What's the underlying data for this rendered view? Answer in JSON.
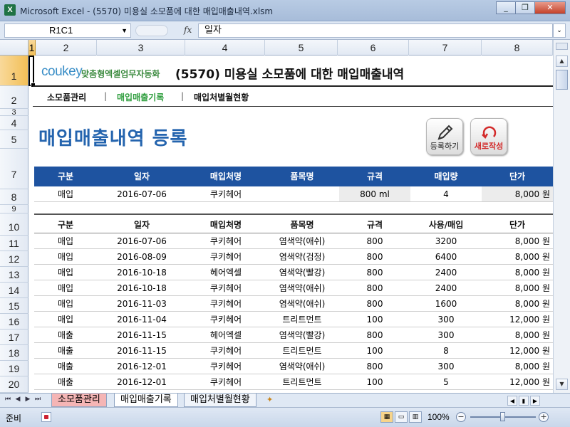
{
  "window": {
    "title": "Microsoft Excel - (5570) 미용실 소모품에 대한 매입매출내역.xlsm",
    "app_icon": "X",
    "minimize": "_",
    "restore": "❐",
    "close": "✕"
  },
  "formula_bar": {
    "name_box": "R1C1",
    "fx": "fx",
    "content": "일자"
  },
  "columns": [
    "1",
    "2",
    "3",
    "4",
    "5",
    "6",
    "7",
    "8"
  ],
  "rows": [
    "1",
    "2",
    "3",
    "4",
    "5",
    "7",
    "8",
    "9",
    "10",
    "11",
    "12",
    "13",
    "14",
    "15",
    "16",
    "17",
    "18",
    "19",
    "20"
  ],
  "header": {
    "brand": "coukey",
    "brand_sub": "맞춤형엑셀업무자동화",
    "title": "(5570) 미용실 소모품에 대한 매입매출내역"
  },
  "nav": {
    "item1": "소모품관리",
    "sep": "|",
    "item2": "매입매출기록",
    "item3": "매입처별월현황"
  },
  "page": {
    "heading": "매입매출내역 등록",
    "register_button": "등록하기",
    "new_button": "새로작성"
  },
  "entry_table": {
    "headers": [
      "구분",
      "일자",
      "매입처명",
      "품목명",
      "규격",
      "매입량",
      "단가"
    ],
    "row": [
      "매입",
      "2016-07-06",
      "쿠키헤어",
      "",
      "800 ml",
      "4",
      "8,000 원"
    ]
  },
  "list_table": {
    "headers": [
      "구분",
      "일자",
      "매입처명",
      "품목명",
      "규격",
      "사용/매입",
      "단가"
    ],
    "rows": [
      [
        "매입",
        "2016-07-06",
        "쿠키헤어",
        "염색약(애쉬)",
        "800",
        "3200",
        "8,000 원"
      ],
      [
        "매입",
        "2016-08-09",
        "쿠키헤어",
        "염색약(검정)",
        "800",
        "6400",
        "8,000 원"
      ],
      [
        "매입",
        "2016-10-18",
        "헤어엑셀",
        "염색약(빨강)",
        "800",
        "2400",
        "8,000 원"
      ],
      [
        "매입",
        "2016-10-18",
        "쿠키헤어",
        "염색약(애쉬)",
        "800",
        "2400",
        "8,000 원"
      ],
      [
        "매입",
        "2016-11-03",
        "쿠키헤어",
        "염색약(애쉬)",
        "800",
        "1600",
        "8,000 원"
      ],
      [
        "매입",
        "2016-11-04",
        "쿠키헤어",
        "트리트먼트",
        "100",
        "300",
        "12,000 원"
      ],
      [
        "매출",
        "2016-11-15",
        "헤어엑셀",
        "염색약(빨강)",
        "800",
        "300",
        "8,000 원"
      ],
      [
        "매출",
        "2016-11-15",
        "쿠키헤어",
        "트리트먼트",
        "100",
        "8",
        "12,000 원"
      ],
      [
        "매출",
        "2016-12-01",
        "쿠키헤어",
        "염색약(애쉬)",
        "800",
        "300",
        "8,000 원"
      ],
      [
        "매출",
        "2016-12-01",
        "쿠키헤어",
        "트리트먼트",
        "100",
        "5",
        "12,000 원"
      ]
    ]
  },
  "sheet_tabs": {
    "tab1": "소모품관리",
    "tab2": "매입매출기록",
    "tab3": "매입처별월현황"
  },
  "status": {
    "ready": "준비",
    "zoom": "100%"
  }
}
